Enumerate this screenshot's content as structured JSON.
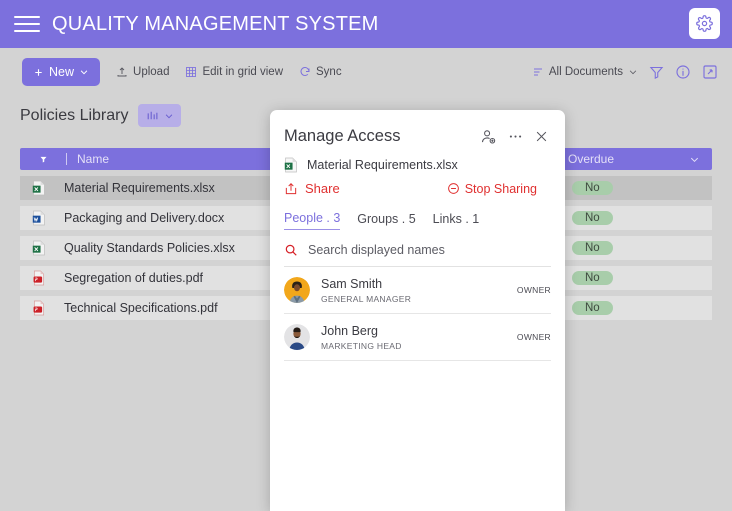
{
  "header": {
    "title": "QUALITY MANAGEMENT SYSTEM",
    "menu_icon": "hamburger-icon",
    "settings_icon": "gear-icon"
  },
  "toolbar": {
    "new_label": "New",
    "upload_label": "Upload",
    "edit_grid_label": "Edit in grid view",
    "sync_label": "Sync",
    "view_label": "All Documents",
    "filter_icon": "funnel-icon",
    "info_icon": "info-icon",
    "expand_icon": "expand-icon"
  },
  "library": {
    "title": "Policies Library",
    "chart_icon": "bar-chart-icon"
  },
  "table": {
    "columns": [
      {
        "label": "Name"
      },
      {
        "label": "Overdue"
      }
    ],
    "rows": [
      {
        "name": "Material Requirements.xlsx",
        "type": "xlsx",
        "overdue": "No",
        "selected": true
      },
      {
        "name": "Packaging and Delivery.docx",
        "type": "docx",
        "overdue": "No",
        "selected": false
      },
      {
        "name": "Quality Standards Policies.xlsx",
        "type": "xlsx",
        "overdue": "No",
        "selected": false
      },
      {
        "name": "Segregation of duties.pdf",
        "type": "pdf",
        "overdue": "No",
        "selected": false
      },
      {
        "name": "Technical Specifications.pdf",
        "type": "pdf",
        "overdue": "No",
        "selected": false
      }
    ]
  },
  "dialog": {
    "title": "Manage Access",
    "add_person_icon": "add-person-icon",
    "more_icon": "more-options-icon",
    "close_icon": "close-icon",
    "file_name": "Material Requirements.xlsx",
    "share_label": "Share",
    "stop_sharing_label": "Stop Sharing",
    "tabs": [
      {
        "label": "People . 3",
        "active": true
      },
      {
        "label": "Groups . 5",
        "active": false
      },
      {
        "label": "Links . 1",
        "active": false
      }
    ],
    "search": {
      "placeholder": "Search displayed names",
      "value": "",
      "icon": "search-icon"
    },
    "people": [
      {
        "name": "Sam Smith",
        "role": "GENERAL MANAGER",
        "permission": "OWNER",
        "avatar_bg": "#f2a71b"
      },
      {
        "name": "John Berg",
        "role": "MARKETING HEAD",
        "permission": "OWNER",
        "avatar_bg": "#e3e3e5"
      }
    ]
  },
  "colors": {
    "brand": "#7c70dd",
    "page_bg": "#d3d3d3",
    "row_bg": "#e1e1e1",
    "row_selected": "#c2c2c2",
    "pill_green": "#a8cdaa",
    "accent_red": "#e03030"
  }
}
